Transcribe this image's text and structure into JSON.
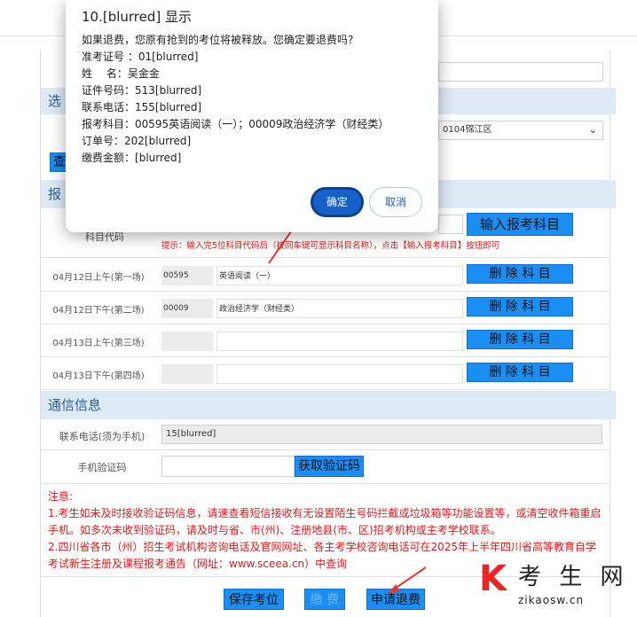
{
  "dialog": {
    "title": "10.[blurred] 显示",
    "message": "如果退费，您原有抢到的考位将被释放。您确定要退费吗?",
    "fields": [
      {
        "label": "准考证号 ：",
        "value": "01[blurred]"
      },
      {
        "label": "姓　 名：",
        "value": "吴金金"
      },
      {
        "label": "证件号码：",
        "value": "513[blurred]"
      },
      {
        "label": "联系电话：",
        "value": "155[blurred]"
      },
      {
        "label": "报考科目：",
        "value": "00595英语阅读（一）；00009政治经济学（财经类）"
      },
      {
        "label": "订单号：",
        "value": "202[blurred]"
      },
      {
        "label": "缴费金额：",
        "value": "[blurred]"
      }
    ],
    "ok": "确定",
    "cancel": "取消"
  },
  "page": {
    "section_select_partial": "选",
    "section_apply_partial": "报",
    "select_value_partial": "0104锦江区",
    "blue_partial": "查",
    "subject_code_label": "科目代码",
    "input_subject_button": "输入报考科目",
    "hint": "提示：输入完5位科目代码后（按回车键可显示科目名称），点击【输入报考科目】按钮即可",
    "sessions": [
      {
        "label": "04月12日上午(第一场)",
        "code": "00595",
        "name": "英语阅读（一）",
        "button": "删 除 科 目"
      },
      {
        "label": "04月12日下午(第二场)",
        "code": "00009",
        "name": "政治经济学（财经类）",
        "button": "删 除 科 目"
      },
      {
        "label": "04月13日上午(第三场)",
        "code": "",
        "name": "",
        "button": "删 除 科 目"
      },
      {
        "label": "04月13日下午(第四场)",
        "code": "",
        "name": "",
        "button": "删 除 科 目"
      }
    ],
    "contact_section": "通信信息",
    "phone_label": "联系电话(须为手机)",
    "phone_value": "15[blurred]",
    "code_label": "手机验证码",
    "get_code_button": "获取验证码",
    "notes": [
      "注意:",
      "1.考生如未及时接收验证码信息，请速查看短信接收有无设置陌生号码拦截或垃圾箱等功能设置等，或清空收件箱重启手机。如多次未收到验证码，请及时与省、市(州)、注册地县(市、区)招考机构或主考学校联系。",
      "2.四川省各市（州）招生考试机构咨询电话及官网网址、各主考学校咨询电话可在2025年上半年四川省高等教育自学考试新生注册及课程报考通告（网址：www.sceea.cn）中查询"
    ],
    "save_button": "保存考位",
    "pay_button": "缴 费",
    "refund_button": "申请退费"
  },
  "watermark": {
    "letter": "K",
    "text": "考 生 网",
    "url": "zikaosw.cn"
  },
  "colors": {
    "accent": "#1a8ef2",
    "section_bg": "#dde9f5",
    "warning": "#e01818",
    "arrow": "#e53935"
  }
}
